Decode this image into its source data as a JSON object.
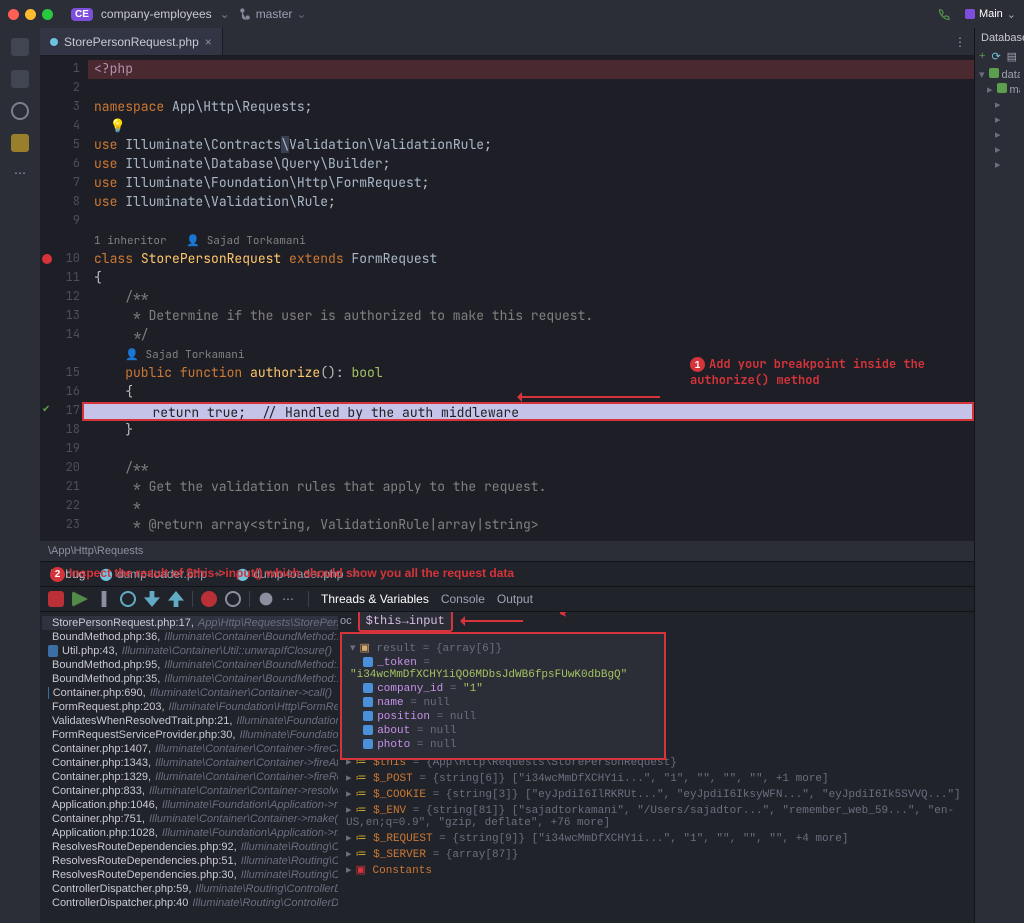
{
  "titlebar": {
    "project_badge": "CE",
    "project_name": "company-employees",
    "branch": "master",
    "run_config": "Main"
  },
  "right_panel": {
    "title": "Database",
    "tree": [
      "datab",
      "ma"
    ]
  },
  "editor": {
    "tab_name": "StorePersonRequest.php",
    "breadcrumb": "\\App\\Http\\Requests",
    "inheritor_hint": "1 inheritor",
    "author_hint": "Sajad Torkamani",
    "lines": [
      {
        "n": 1,
        "html": "<span class='purple'>&lt;?php</span>",
        "cls": "hl-red"
      },
      {
        "n": 2,
        "html": ""
      },
      {
        "n": 3,
        "html": "<span class='kw'>namespace</span> <span class='cls'>App\\Http\\Requests</span>;"
      },
      {
        "n": 4,
        "html": "  <span style='color:#c9b25a'>💡</span>"
      },
      {
        "n": 5,
        "html": "<span class='kw'>use</span> <span class='cls'>Illuminate\\Contracts<span style='background:#3b3f54'>\\</span>Validation\\ValidationRule</span>;"
      },
      {
        "n": 6,
        "html": "<span class='kw'>use</span> <span class='cls'>Illuminate\\Database\\Query\\Builder</span>;"
      },
      {
        "n": 7,
        "html": "<span class='kw'>use</span> <span class='cls'>Illuminate\\Foundation\\Http\\FormRequest</span>;"
      },
      {
        "n": 8,
        "html": "<span class='kw'>use</span> <span class='cls'>Illuminate\\Validation\\Rule</span>;"
      },
      {
        "n": 9,
        "html": ""
      },
      {
        "n": "",
        "html": "<span class='inheritor'>1 inheritor&nbsp;&nbsp;&nbsp;👤 Sajad Torkamani</span>"
      },
      {
        "n": 10,
        "html": "<span class='kw'>class</span> <span class='fn'>StorePersonRequest</span> <span class='kw'>extends</span> <span class='cls'>FormRequest</span>",
        "gut": "bp"
      },
      {
        "n": 11,
        "html": "{"
      },
      {
        "n": 12,
        "html": "    <span class='cmt'>/**</span>"
      },
      {
        "n": 13,
        "html": "<span class='cmt'>     * Determine if the user is authorized to make this request.</span>"
      },
      {
        "n": 14,
        "html": "<span class='cmt'>     */</span>"
      },
      {
        "n": "",
        "html": "    <span class='inheritor'>👤 Sajad Torkamani</span>"
      },
      {
        "n": 15,
        "html": "    <span class='kw'>public function</span> <span class='fn'>authorize</span>(): <span class='ty'>bool</span>"
      },
      {
        "n": 16,
        "html": "    {"
      },
      {
        "n": 17,
        "html": "        <span style='color:#1e1f26'>return</span> <span style='color:#1e1f26'>true;  // Handled by the auth middleware</span>",
        "cls": "hl-sel",
        "gut": "ok"
      },
      {
        "n": 18,
        "html": "    }"
      },
      {
        "n": 19,
        "html": ""
      },
      {
        "n": 20,
        "html": "    <span class='cmt'>/**</span>"
      },
      {
        "n": 21,
        "html": "<span class='cmt'>     * Get the validation rules that apply to the request.</span>"
      },
      {
        "n": 22,
        "html": "<span class='cmt'>     *</span>"
      },
      {
        "n": 23,
        "html": "<span class='cmt'>     * @return array&lt;string, ValidationRule|array|string&gt;</span>"
      }
    ]
  },
  "annotations": {
    "a1": "Add your breakpoint inside the authorize() method",
    "a2": "Inspect the result of $this->input() which should show you all the request data"
  },
  "debug": {
    "title": "Debug",
    "run_tabs": [
      "dump-loader.php",
      "dump-loader.php"
    ],
    "sub_tabs": [
      "Threads & Variables",
      "Console",
      "Output"
    ],
    "eval_expr": "$this→input()",
    "frames": [
      {
        "loc": "StorePersonRequest.php:17,",
        "path": "App\\Http\\Requests\\StorePers",
        "active": true
      },
      {
        "loc": "BoundMethod.php:36,",
        "path": "Illuminate\\Container\\BoundMethod::"
      },
      {
        "loc": "Util.php:43,",
        "path": "Illuminate\\Container\\Util::unwrapIfClosure()"
      },
      {
        "loc": "BoundMethod.php:95,",
        "path": "Illuminate\\Container\\BoundMethod::c"
      },
      {
        "loc": "BoundMethod.php:35,",
        "path": "Illuminate\\Container\\BoundMethod::c"
      },
      {
        "loc": "Container.php:690,",
        "path": "Illuminate\\Container\\Container->call()"
      },
      {
        "loc": "FormRequest.php:203,",
        "path": "Illuminate\\Foundation\\Http\\FormReq"
      },
      {
        "loc": "ValidatesWhenResolvedTrait.php:21,",
        "path": "Illuminate\\Foundation"
      },
      {
        "loc": "FormRequestServiceProvider.php:30,",
        "path": "Illuminate\\Foundation"
      },
      {
        "loc": "Container.php:1407,",
        "path": "Illuminate\\Container\\Container->fireCal"
      },
      {
        "loc": "Container.php:1343,",
        "path": "Illuminate\\Container\\Container->fireAft"
      },
      {
        "loc": "Container.php:1329,",
        "path": "Illuminate\\Container\\Container->fireRes"
      },
      {
        "loc": "Container.php:833,",
        "path": "Illuminate\\Container\\Container->resolve"
      },
      {
        "loc": "Application.php:1046,",
        "path": "Illuminate\\Foundation\\Application->re"
      },
      {
        "loc": "Container.php:751,",
        "path": "Illuminate\\Container\\Container->make()"
      },
      {
        "loc": "Application.php:1028,",
        "path": "Illuminate\\Foundation\\Application->ma"
      },
      {
        "loc": "ResolvesRouteDependencies.php:92,",
        "path": "Illuminate\\Routing\\Cor"
      },
      {
        "loc": "ResolvesRouteDependencies.php:51,",
        "path": "Illuminate\\Routing\\Con"
      },
      {
        "loc": "ResolvesRouteDependencies.php:30,",
        "path": "Illuminate\\Routing\\Con"
      },
      {
        "loc": "ControllerDispatcher.php:59,",
        "path": "Illuminate\\Routing\\ControllerDi"
      },
      {
        "loc": "ControllerDispatcher.php:40",
        "path": "Illuminate\\Routing\\ControllerDi"
      }
    ],
    "result": {
      "header": "result = {array[6]}",
      "items": [
        {
          "k": "_token",
          "v": "\"i34wcMmDfXCHY1iQO6MDbsJdWB6fpsFUwK0dbBgQ\""
        },
        {
          "k": "company_id",
          "v": "\"1\""
        },
        {
          "k": "name",
          "v": "null",
          "null": true
        },
        {
          "k": "position",
          "v": "null",
          "null": true
        },
        {
          "k": "about",
          "v": "null",
          "null": true
        },
        {
          "k": "photo",
          "v": "null",
          "null": true
        }
      ]
    },
    "superglobals": [
      {
        "nm": "$this",
        "val": "= {App\\Http\\Requests\\StorePersonRequest}"
      },
      {
        "nm": "$_POST",
        "val": "= {string[6]} [\"i34wcMmDfXCHY1i...\", \"1\", \"\", \"\", \"\", +1 more]"
      },
      {
        "nm": "$_COOKIE",
        "val": "= {string[3]} [\"eyJpdiI6IlRKRUt...\", \"eyJpdiI6IksyWFN...\", \"eyJpdiI6Ik5SVVQ...\"]"
      },
      {
        "nm": "$_ENV",
        "val": "= {string[81]} [\"sajadtorkamani\", \"/Users/sajadtor...\", \"remember_web_59...\", \"en-US,en;q=0.9\", \"gzip, deflate\", +76 more]"
      },
      {
        "nm": "$_REQUEST",
        "val": "= {string[9]} [\"i34wcMmDfXCHY1i...\", \"1\", \"\", \"\", \"\", +4 more]"
      },
      {
        "nm": "$_SERVER",
        "val": "= {array[87]}"
      },
      {
        "nm": "Constants",
        "val": "",
        "const": true
      }
    ]
  }
}
